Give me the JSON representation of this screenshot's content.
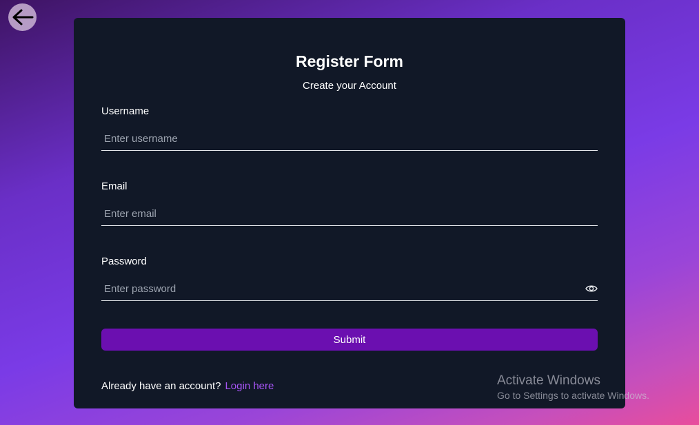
{
  "nav": {
    "back_icon": "arrow-left-icon"
  },
  "form": {
    "title": "Register Form",
    "subtitle": "Create your Account",
    "username": {
      "label": "Username",
      "placeholder": "Enter username",
      "value": ""
    },
    "email": {
      "label": "Email",
      "placeholder": "Enter email",
      "value": ""
    },
    "password": {
      "label": "Password",
      "placeholder": "Enter password",
      "value": "",
      "toggle_icon": "eye-icon"
    },
    "submit_label": "Submit",
    "footer_text": "Already have an account?",
    "login_link": "Login here"
  },
  "colors": {
    "card": "#111827",
    "submit": "#6b0fb0",
    "link": "#a855f7"
  },
  "watermark": {
    "title": "Activate Windows",
    "subtitle": "Go to Settings to activate Windows."
  }
}
